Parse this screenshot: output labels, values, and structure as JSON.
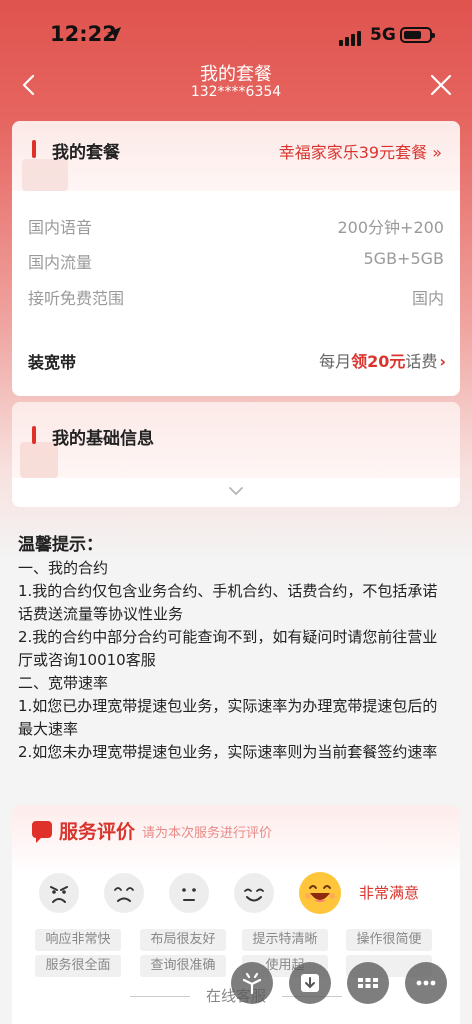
{
  "status_bar": {
    "time": "12:22",
    "network": "5G"
  },
  "nav": {
    "title": "我的套餐",
    "phone": "132****6354"
  },
  "plan": {
    "section_title": "我的套餐",
    "plan_name": "幸福家家乐39元套餐 »",
    "rows": [
      {
        "label": "国内语音",
        "value": "200分钟+200"
      },
      {
        "label": "国内流量",
        "value": "5GB+5GB"
      },
      {
        "label": "接听免费范围",
        "value": "国内"
      }
    ],
    "broadband": {
      "label": "装宽带",
      "promo_prefix": "每月",
      "promo_highlight": "领20元",
      "promo_suffix": "话费"
    }
  },
  "basic_info": {
    "title": "我的基础信息"
  },
  "tips": {
    "title": "温馨提示：",
    "lines": [
      "一、我的合约",
      "1.我的合约仅包含业务合约、手机合约、话费合约，不包括承诺",
      "话费送流量等协议性业务",
      "2.我的合约中部分合约可能查询不到，如有疑问时请您前往营业",
      "厅或咨询10010客服",
      "二、宽带速率",
      "1.如您已办理宽带提速包业务，实际速率为办理宽带提速包后的",
      "最大速率",
      "2.如您未办理宽带提速包业务，实际速率则为当前套餐签约速率"
    ]
  },
  "rating": {
    "title": "服务评价",
    "hint": "请为本次服务进行评价",
    "faces": [
      "angry-face-icon",
      "sad-face-icon",
      "neutral-face-icon",
      "smile-face-icon",
      "laughing-face-icon"
    ],
    "selected_index": 4,
    "selected_label": "非常满意",
    "tags": [
      "响应非常快",
      "布局很友好",
      "提示特清晰",
      "操作很简便"
    ],
    "tags_row2": [
      "服务很全面",
      "查询很准确",
      "使用起",
      ""
    ]
  },
  "bottom": {
    "service_label": "在线客服"
  },
  "colors": {
    "brand_red": "#e0302a",
    "header_red": "#e0534e"
  }
}
